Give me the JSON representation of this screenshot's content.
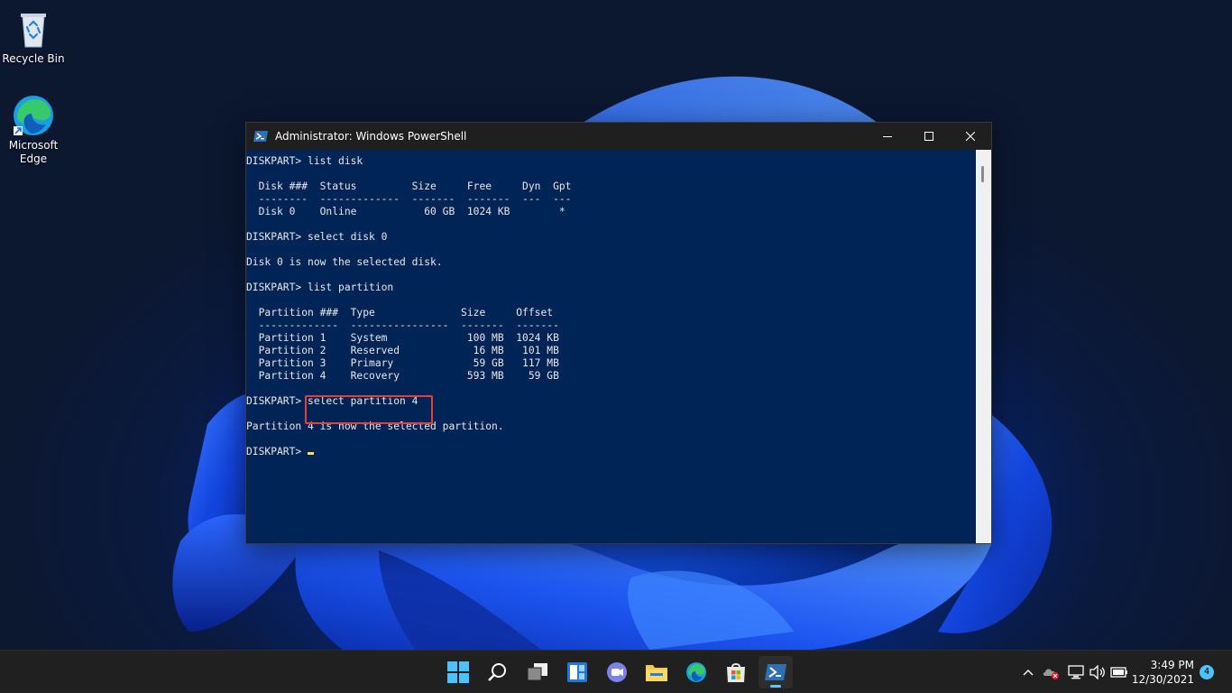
{
  "desktop": {
    "icons": [
      {
        "label": "Recycle Bin",
        "icon": "recycle-bin-icon"
      },
      {
        "label": "Microsoft\nEdge",
        "icon": "edge-icon"
      }
    ]
  },
  "window": {
    "title": "Administrator: Windows PowerShell",
    "controls": {
      "minimize": "minimize-icon",
      "maximize": "maximize-icon",
      "close": "close-icon"
    },
    "console_lines": [
      "DISKPART> list disk",
      "",
      "  Disk ###  Status         Size     Free     Dyn  Gpt",
      "  --------  -------------  -------  -------  ---  ---",
      "  Disk 0    Online           60 GB  1024 KB        *",
      "",
      "DISKPART> select disk 0",
      "",
      "Disk 0 is now the selected disk.",
      "",
      "DISKPART> list partition",
      "",
      "  Partition ###  Type              Size     Offset",
      "  -------------  ----------------  -------  -------",
      "  Partition 1    System             100 MB  1024 KB",
      "  Partition 2    Reserved            16 MB   101 MB",
      "  Partition 3    Primary             59 GB   117 MB",
      "  Partition 4    Recovery           593 MB    59 GB",
      "",
      "DISKPART> select partition 4",
      "",
      "Partition 4 is now the selected partition.",
      "",
      "DISKPART> "
    ],
    "highlight_color": "#e0403a",
    "background_color": "#012456"
  },
  "taskbar": {
    "apps": [
      {
        "name": "start-button",
        "icon": "windows-logo-icon"
      },
      {
        "name": "search-button",
        "icon": "search-icon"
      },
      {
        "name": "task-view-button",
        "icon": "task-view-icon"
      },
      {
        "name": "widgets-button",
        "icon": "widgets-icon"
      },
      {
        "name": "chat-button",
        "icon": "teams-chat-icon"
      },
      {
        "name": "file-explorer-button",
        "icon": "folder-icon"
      },
      {
        "name": "edge-button",
        "icon": "edge-icon"
      },
      {
        "name": "store-button",
        "icon": "store-icon"
      },
      {
        "name": "powershell-button",
        "icon": "powershell-icon",
        "active": true
      }
    ],
    "tray": {
      "time": "3:49 PM",
      "date": "12/30/2021",
      "notification_count": "4"
    }
  }
}
